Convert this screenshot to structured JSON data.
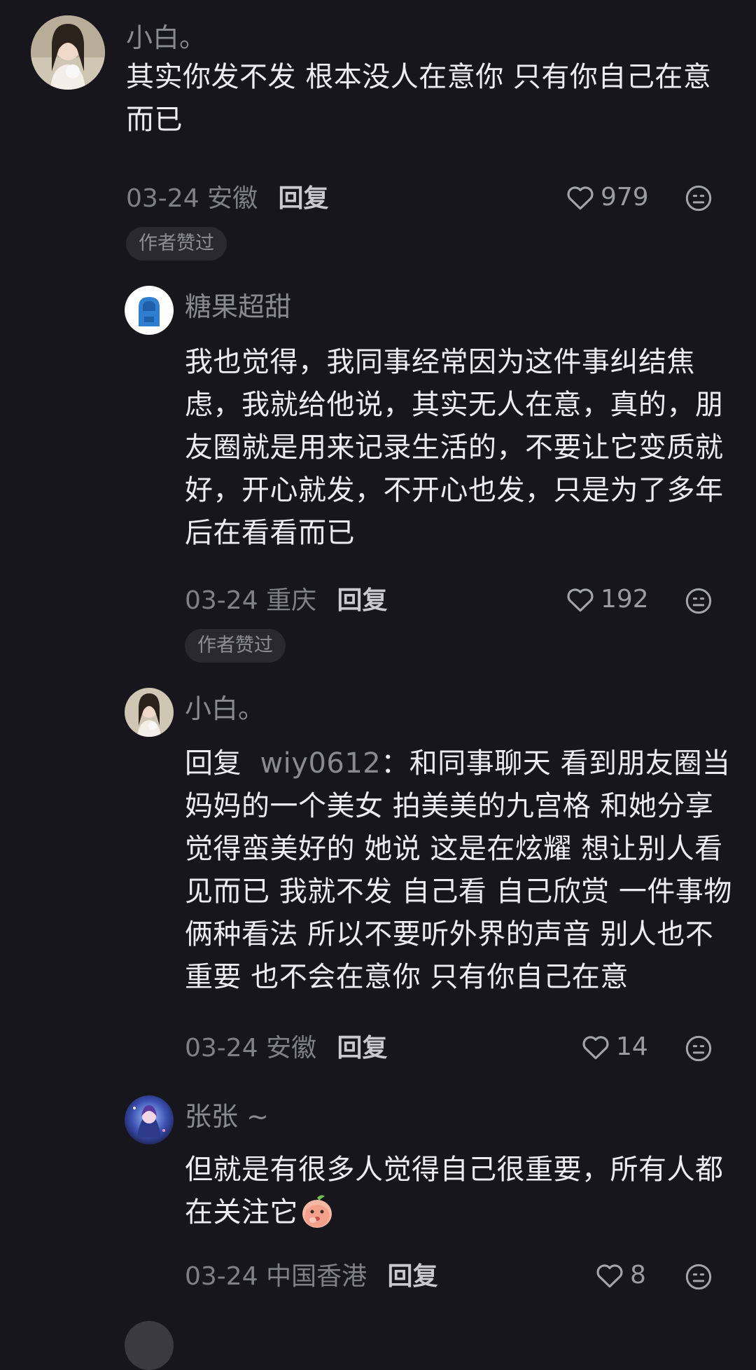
{
  "comments": [
    {
      "username": "小白。",
      "text": "其实你发不发 根本没人在意你 只有你自己在意而已",
      "text_lines": [
        "其实你发不发 根本没人在意你 只有你自己在意",
        "而已"
      ],
      "date": "03-24",
      "location": "安徽",
      "reply_label": "回复",
      "likes": "979",
      "badge": "作者赞过",
      "avatar_icon": "user-avatar-icon"
    },
    {
      "username": "糖果超甜",
      "text_lines": [
        "我也觉得，我同事经常因为这件事纠结焦",
        "虑，我就给他说，其实无人在意，真的，朋",
        "友圈就是用来记录生活的，不要让它变质就",
        "好，开心就发，不开心也发，只是为了多年",
        "后在看看而已"
      ],
      "date": "03-24",
      "location": "重庆",
      "reply_label": "回复",
      "likes": "192",
      "badge": "作者赞过",
      "avatar_icon": "hoodie-avatar-icon"
    },
    {
      "username": "小白。",
      "reply_prefix": "回复",
      "mention": "wiy0612",
      "text_lines": [
        "：和同事聊天 看到朋友圈当",
        "妈妈的一个美女 拍美美的九宫格 和她分享",
        "觉得蛮美好的  她说 这是在炫耀 想让别人看",
        "见而已 我就不发 自己看 自己欣赏 一件事物",
        "俩种看法 所以不要听外界的声音 别人也不",
        "重要 也不会在意你 只有你自己在意"
      ],
      "date": "03-24",
      "location": "安徽",
      "reply_label": "回复",
      "likes": "14",
      "avatar_icon": "user-avatar-icon"
    },
    {
      "username": "张张 ~",
      "text_lines": [
        "但就是有很多人觉得自己很重要，所有人都",
        "在关注它"
      ],
      "date": "03-24",
      "location": "中国香港",
      "reply_label": "回复",
      "likes": "8",
      "avatar_icon": "anime-avatar-icon",
      "emoji_icon": "peach-emoji-icon"
    }
  ],
  "colors": {
    "background": "#17161d",
    "text": "#ececf1",
    "muted": "#8a8a92",
    "badge_bg": "#2a2930"
  }
}
